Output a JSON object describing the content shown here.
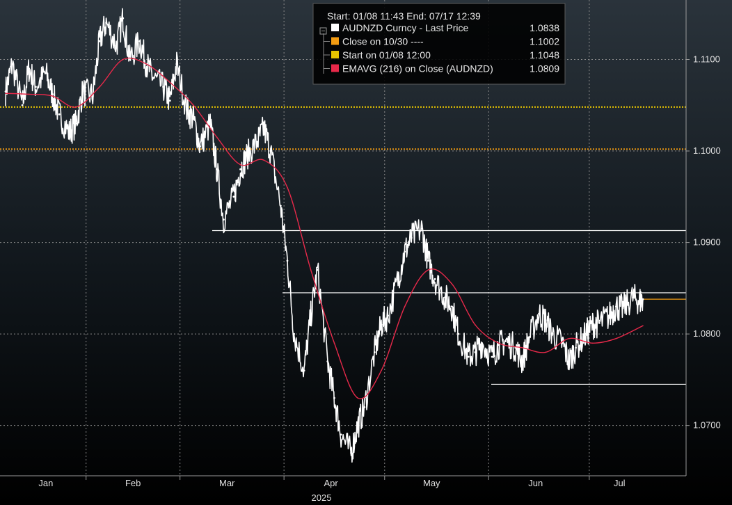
{
  "chart_data": {
    "type": "line",
    "header": "Start: 01/08 11:43 End: 07/17 12:39",
    "year_label": "2025",
    "ylim": [
      1.0645,
      1.1165
    ],
    "y_ticks": [
      "1.0700",
      "1.0800",
      "1.0900",
      "1.1000",
      "1.1100"
    ],
    "x_months": [
      "Jan",
      "Feb",
      "Mar",
      "Apr",
      "May",
      "Jun",
      "Jul"
    ],
    "legend": [
      {
        "label": "AUDNZD Curncy - Last Price",
        "value": "1.0838",
        "color": "#ffffff"
      },
      {
        "label": "Close on 10/30 ----",
        "value": "1.1002",
        "color": "#f39c12"
      },
      {
        "label": "Start on 01/08 12:00",
        "value": "1.1048",
        "color": "#e6c300"
      },
      {
        "label": "EMAVG (216)  on Close (AUDNZD)",
        "value": "1.0809",
        "color": "#e8294a"
      }
    ],
    "reference_lines": [
      {
        "value": 1.1002,
        "color": "#f39c12",
        "style": "dotted"
      },
      {
        "value": 1.1048,
        "color": "#e6c300",
        "style": "dotted"
      }
    ],
    "support_resistance_levels": [
      1.0913,
      1.0845,
      1.0745
    ],
    "last_price": 1.0838,
    "series": [
      {
        "name": "AUDNZD Curncy - Last Price",
        "color": "#ffffff",
        "x": [
          "01-08",
          "01-10",
          "01-13",
          "01-15",
          "01-17",
          "01-20",
          "01-22",
          "01-24",
          "01-27",
          "01-29",
          "01-31",
          "02-03",
          "02-05",
          "02-07",
          "02-10",
          "02-12",
          "02-14",
          "02-17",
          "02-19",
          "02-21",
          "02-24",
          "02-26",
          "02-28",
          "03-03",
          "03-05",
          "03-07",
          "03-10",
          "03-12",
          "03-14",
          "03-17",
          "03-19",
          "03-21",
          "03-24",
          "03-26",
          "03-28",
          "03-31",
          "04-02",
          "04-04",
          "04-07",
          "04-09",
          "04-11",
          "04-14",
          "04-16",
          "04-18",
          "04-21",
          "04-23",
          "04-25",
          "04-28",
          "04-30",
          "05-02",
          "05-05",
          "05-07",
          "05-09",
          "05-12",
          "05-14",
          "05-16",
          "05-19",
          "05-21",
          "05-23",
          "05-26",
          "05-28",
          "05-30",
          "06-02",
          "06-04",
          "06-06",
          "06-09",
          "06-11",
          "06-13",
          "06-16",
          "06-18",
          "06-20",
          "06-23",
          "06-25",
          "06-27",
          "06-30",
          "07-02",
          "07-04",
          "07-07",
          "07-09",
          "07-11",
          "07-14",
          "07-16",
          "07-17"
        ],
        "values": [
          1.1065,
          1.1095,
          1.105,
          1.109,
          1.107,
          1.1085,
          1.1062,
          1.104,
          1.102,
          1.103,
          1.1065,
          1.106,
          1.112,
          1.114,
          1.1115,
          1.1145,
          1.11,
          1.112,
          1.1095,
          1.108,
          1.107,
          1.1055,
          1.1095,
          1.1045,
          1.1035,
          1.1005,
          1.103,
          1.098,
          1.0925,
          1.095,
          1.098,
          1.0995,
          1.101,
          1.1025,
          1.1,
          1.094,
          1.088,
          1.08,
          1.076,
          1.082,
          1.087,
          1.077,
          1.073,
          1.069,
          1.067,
          1.07,
          1.072,
          1.078,
          1.081,
          1.082,
          1.086,
          1.089,
          1.0905,
          1.0915,
          1.088,
          1.086,
          1.084,
          1.083,
          1.08,
          1.0775,
          1.078,
          1.079,
          1.0775,
          1.0788,
          1.0792,
          1.0785,
          1.077,
          1.0795,
          1.0822,
          1.0815,
          1.08,
          1.079,
          1.077,
          1.0785,
          1.08,
          1.081,
          1.0812,
          1.082,
          1.083,
          1.0828,
          1.084,
          1.0836,
          1.0838
        ]
      },
      {
        "name": "EMAVG (216)  on Close (AUDNZD)",
        "color": "#e8294a",
        "x": [
          "01-08",
          "01-15",
          "01-22",
          "01-29",
          "02-05",
          "02-12",
          "02-19",
          "02-26",
          "03-05",
          "03-12",
          "03-19",
          "03-26",
          "04-02",
          "04-09",
          "04-16",
          "04-23",
          "04-30",
          "05-07",
          "05-14",
          "05-21",
          "05-28",
          "06-04",
          "06-11",
          "06-18",
          "06-25",
          "07-02",
          "07-09",
          "07-17"
        ],
        "values": [
          1.1063,
          1.1062,
          1.106,
          1.1048,
          1.107,
          1.11,
          1.1095,
          1.1075,
          1.105,
          1.1015,
          1.0985,
          1.099,
          1.096,
          1.087,
          1.079,
          1.073,
          1.076,
          1.083,
          1.087,
          1.0855,
          1.081,
          1.079,
          1.0785,
          1.078,
          1.0795,
          1.079,
          1.0795,
          1.0809
        ]
      }
    ]
  }
}
